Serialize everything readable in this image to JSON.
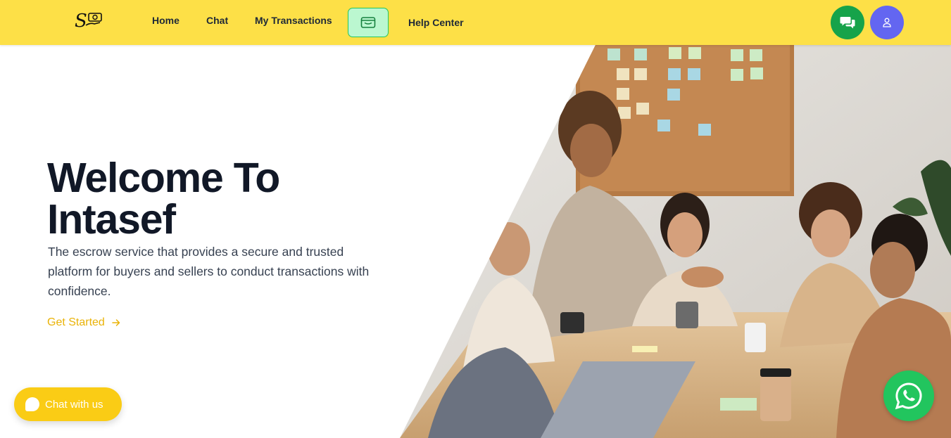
{
  "header": {
    "logo_icon": "intasef-logo-icon",
    "nav": {
      "home": "Home",
      "chat": "Chat",
      "transactions": "My Transactions",
      "wallet_icon": "wallet-icon",
      "help": "Help Center"
    },
    "chat_icon": "chat-bubbles-icon",
    "user_icon": "user-icon"
  },
  "hero": {
    "title_line1": "Welcome To",
    "title_line2": "Intasef",
    "description": "The escrow service that provides a secure and trusted platform for buyers and sellers to conduct transactions with confidence.",
    "cta_label": "Get Started",
    "cta_icon": "arrow-right-icon"
  },
  "floating": {
    "chat_with_us": "Chat with us",
    "whatsapp_icon": "whatsapp-icon"
  },
  "colors": {
    "header_bg": "#fde047",
    "accent": "#eab308",
    "chat_green": "#16a34a",
    "user_indigo": "#6366f1",
    "whatsapp_green": "#22c55e"
  }
}
